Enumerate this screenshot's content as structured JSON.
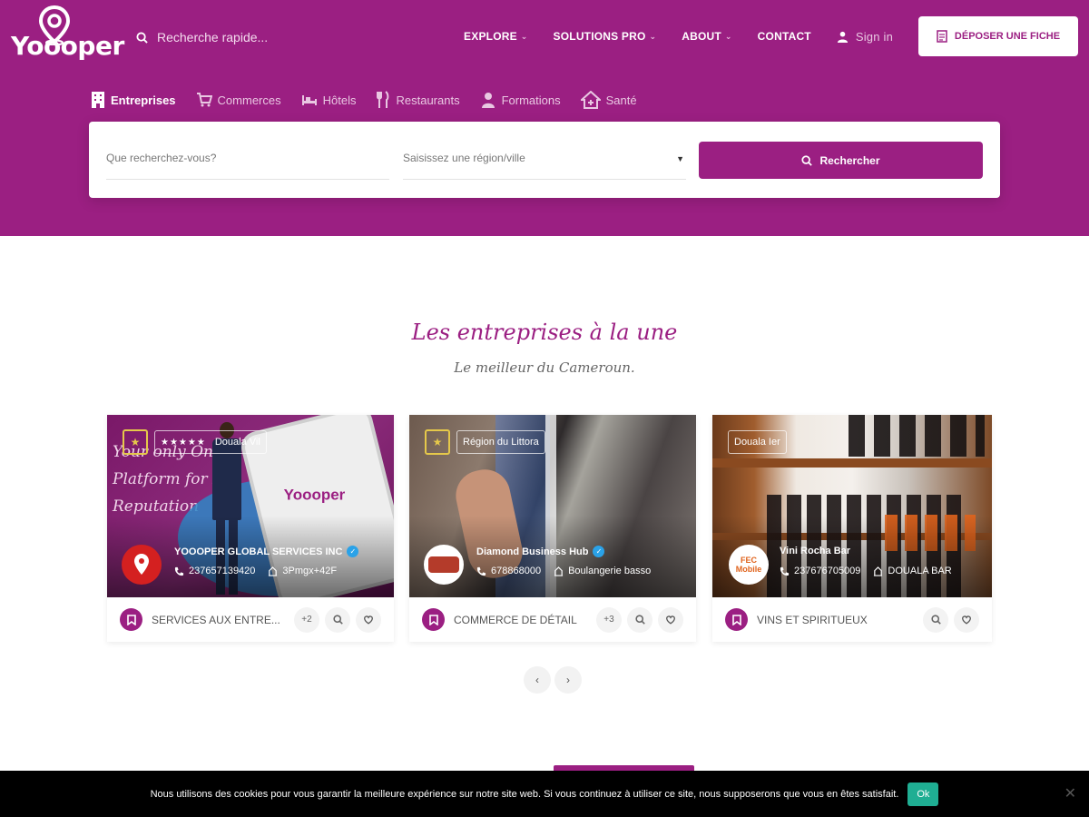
{
  "header": {
    "logo_text": "Yoooper",
    "quick_search_placeholder": "Recherche rapide...",
    "nav": [
      {
        "label": "EXPLORE",
        "caret": "⌄"
      },
      {
        "label": "SOLUTIONS PRO",
        "caret": "⌄"
      },
      {
        "label": "ABOUT",
        "caret": "⌄"
      },
      {
        "label": "CONTACT"
      }
    ],
    "signin_label": "Sign in",
    "deposer_label": "DÉPOSER UNE FICHE"
  },
  "categories": [
    {
      "label": "Entreprises",
      "icon": "building-icon"
    },
    {
      "label": "Commerces",
      "icon": "cart-icon"
    },
    {
      "label": "Hôtels",
      "icon": "bed-icon"
    },
    {
      "label": "Restaurants",
      "icon": "fork-knife-icon"
    },
    {
      "label": "Formations",
      "icon": "graduate-icon"
    },
    {
      "label": "Santé",
      "icon": "house-medical-icon"
    }
  ],
  "search": {
    "what_placeholder": "Que recherchez-vous?",
    "where_placeholder": "Saisissez une région/ville",
    "button_label": "Rechercher"
  },
  "section": {
    "title": "Les entreprises à la une",
    "subtitle": "Le meilleur du Cameroun."
  },
  "cards": [
    {
      "tag": "Douala Vil",
      "stars": "★★★★★",
      "name": "YOOOPER GLOBAL SERVICES INC",
      "phone": "237657139420",
      "place": "3Pmgx+42F",
      "category": "SERVICES AUX ENTRE...",
      "more": "+2",
      "image_text": "Your only One Platform for E-Reputation",
      "image_logo": "Yoooper"
    },
    {
      "tag": "Région du Littora",
      "name": "Diamond Business Hub",
      "phone": "678868000",
      "place": "Boulangerie basso",
      "category": "COMMERCE DE DÉTAIL",
      "more": "+3"
    },
    {
      "tag": "Douala Ier",
      "name": "Vini Rocha Bar",
      "phone": "237676705009",
      "place": "DOUALA BAR",
      "category": "VINS ET SPIRITUEUX",
      "avatar_text": "FEC Mobile"
    }
  ],
  "pager": {
    "prev": "‹",
    "next": "›"
  },
  "cookie": {
    "text": "Nous utilisons des cookies pour vous garantir la meilleure expérience sur notre site web. Si vous continuez à utiliser ce site, nous supposerons que vous en êtes satisfait.",
    "ok_label": "Ok",
    "close_label": "✕"
  },
  "colors": {
    "brand": "#9b1f82",
    "verified": "#2aa2e8",
    "ok": "#1fae93",
    "star": "#e5c84a"
  }
}
